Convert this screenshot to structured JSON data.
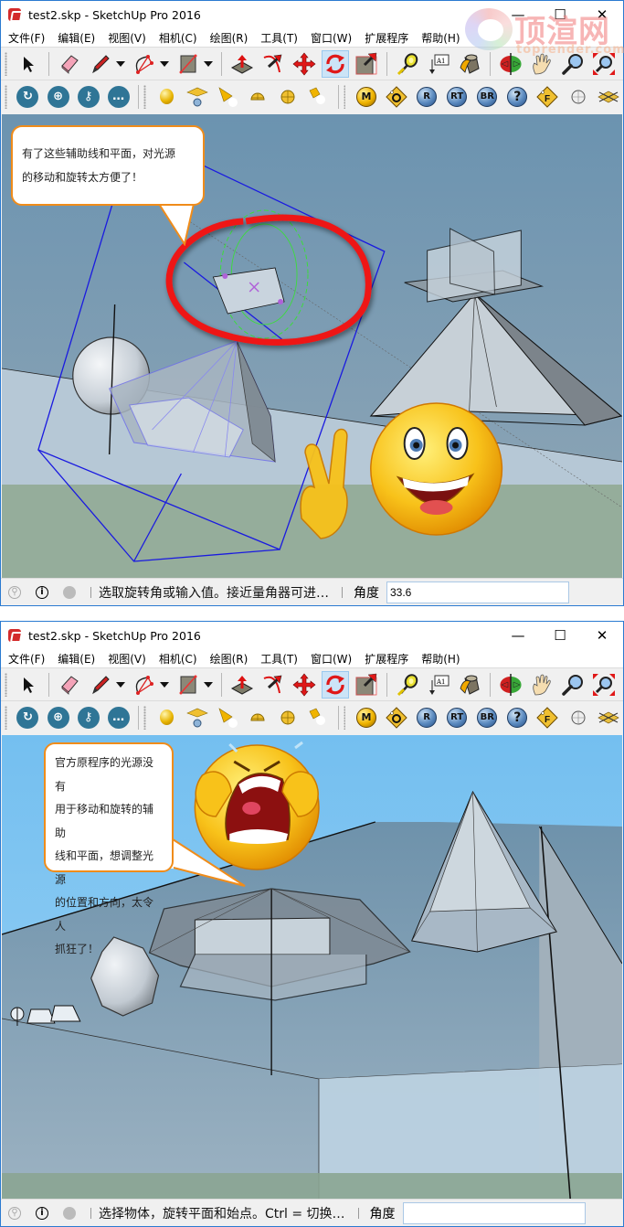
{
  "watermark": {
    "brand": "顶渲网",
    "domain": "toprender.com"
  },
  "windows": [
    {
      "title": "test2.skp - SketchUp Pro 2016",
      "controls": {
        "minimize": "—",
        "maximize": "☐",
        "close": "✕"
      },
      "menu": [
        "文件(F)",
        "编辑(E)",
        "视图(V)",
        "相机(C)",
        "绘图(R)",
        "工具(T)",
        "窗口(W)",
        "扩展程序",
        "帮助(H)"
      ],
      "toolbar_main": {
        "tools": [
          "select",
          "eraser",
          "pencil-line",
          "arc",
          "rectangle",
          "push-pull",
          "follow-me",
          "move",
          "rotate",
          "scale",
          "tape-measure",
          "text",
          "paint-bucket",
          "orbit",
          "pan",
          "zoom",
          "zoom-extents"
        ],
        "active_tool": "rotate"
      },
      "toolbar_second": {
        "group1": [
          "3d-warehouse",
          "extension-warehouse",
          "layout",
          "share"
        ],
        "group2": [
          "point-light",
          "spot-light-plane",
          "spot-light",
          "dome-light",
          "sphere-light",
          "ies-light"
        ],
        "group3": [
          {
            "name": "material-editor",
            "label": "M"
          },
          {
            "name": "options-tag",
            "label": "O"
          },
          {
            "name": "render",
            "label": "R"
          },
          {
            "name": "render-region",
            "label": "RT"
          },
          {
            "name": "batch-render",
            "label": "BR"
          },
          {
            "name": "help",
            "label": "?"
          },
          {
            "name": "frame-tag",
            "label": "F"
          },
          {
            "name": "sphere-object",
            "label": ""
          },
          {
            "name": "plane-object",
            "label": ""
          }
        ]
      },
      "bubble": {
        "lines": [
          "有了这些辅助线和平面，对光源",
          "的移动和旋转太方便了！"
        ]
      },
      "emoji": "happy-peace-sign",
      "status": {
        "message": "选取旋转角或输入值。接近量角器可进…",
        "vcb_label": "角度",
        "vcb_value": "33.6"
      }
    },
    {
      "title": "test2.skp - SketchUp Pro 2016",
      "controls": {
        "minimize": "—",
        "maximize": "☐",
        "close": "✕"
      },
      "menu": [
        "文件(F)",
        "编辑(E)",
        "视图(V)",
        "相机(C)",
        "绘图(R)",
        "工具(T)",
        "窗口(W)",
        "扩展程序",
        "帮助(H)"
      ],
      "toolbar_main": {
        "active_tool": "rotate"
      },
      "bubble": {
        "lines": [
          "官方原程序的光源没有",
          "用于移动和旋转的辅助",
          "线和平面，想调整光源",
          "的位置和方向，太令人",
          "抓狂了！"
        ]
      },
      "emoji": "crying",
      "status": {
        "message": "选择物体，旋转平面和始点。Ctrl = 切换…",
        "vcb_label": "角度",
        "vcb_value": ""
      }
    }
  ]
}
